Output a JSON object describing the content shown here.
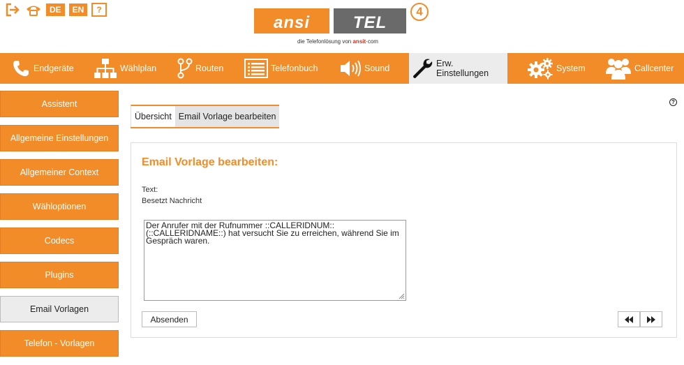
{
  "top_icons": {
    "logout_icon": "logout-icon",
    "phone_icon": "phone-icon",
    "lang_de": "DE",
    "lang_en": "EN",
    "help": "?"
  },
  "logo": {
    "left": "ansi",
    "right": "TEL",
    "version": "4",
    "tagline_prefix": "die Telefonlösung von",
    "tagline_brand": "ansit",
    "tagline_suffix": "com"
  },
  "nav": {
    "items": [
      {
        "label": "Endgeräte",
        "icon": "phone-icon"
      },
      {
        "label": "Wählplan",
        "icon": "sitemap-icon"
      },
      {
        "label": "Routen",
        "icon": "route-icon"
      },
      {
        "label": "Telefonbuch",
        "icon": "list-icon"
      },
      {
        "label": "Sound",
        "icon": "speaker-icon"
      },
      {
        "label": "Erw. Einstellungen",
        "icon": "wrench-icon"
      },
      {
        "label": "System",
        "icon": "gears-icon"
      },
      {
        "label": "Callcenter",
        "icon": "users-icon"
      }
    ],
    "active_index": 5
  },
  "sidebar": {
    "items": [
      {
        "label": "Assistent"
      },
      {
        "label": "Allgemeine Einstellungen"
      },
      {
        "label": "Allgemeiner Context"
      },
      {
        "label": "Wähloptionen"
      },
      {
        "label": "Codecs"
      },
      {
        "label": "Plugins"
      },
      {
        "label": "Email Vorlagen"
      },
      {
        "label": "Telefon - Vorlagen"
      }
    ],
    "active_index": 6
  },
  "help_icon": "?",
  "tabs": [
    {
      "label": "Übersicht"
    },
    {
      "label": "Email Vorlage bearbeiten"
    }
  ],
  "form": {
    "title": "Email Vorlage bearbeiten:",
    "field_label": "Text:",
    "field_sublabel": "Besetzt Nachricht",
    "textarea_value": "Der Anrufer mit der Rufnummer  ::CALLERIDNUM:: (::CALLERIDNAME::) hat versucht Sie zu erreichen, während Sie im Gespräch waren.",
    "submit_label": "Absenden"
  },
  "colors": {
    "accent": "#f28c28",
    "active_bg": "#ececec"
  }
}
